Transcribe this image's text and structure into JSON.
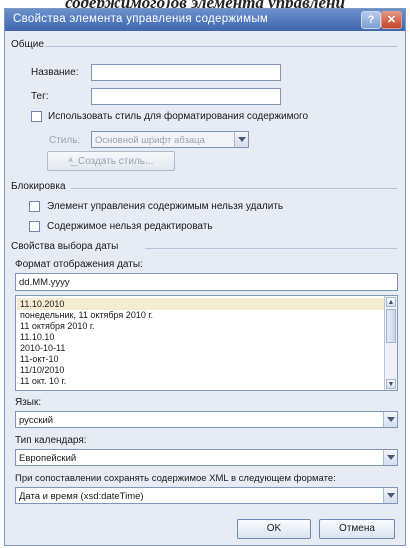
{
  "caption": "содержимого)ов элемента управлени",
  "dialog": {
    "title": "Свойства элемента управления содержимым",
    "help_glyph": "?",
    "close_glyph": "✕"
  },
  "general": {
    "heading": "Общие",
    "name_label": "Название:",
    "name_value": "",
    "tag_label": "Тег:",
    "tag_value": "",
    "use_style_label": "Использовать стиль для форматирования содержимого",
    "use_style_checked": false,
    "style_label": "Стиль:",
    "style_value": "Основной шрифт абзаца",
    "create_style_label": "Создать стиль..."
  },
  "locking": {
    "heading": "Блокировка",
    "cannot_delete_label": "Элемент управления содержимым нельзя удалить",
    "cannot_delete_checked": false,
    "cannot_edit_label": "Содержимое нельзя редактировать",
    "cannot_edit_checked": false
  },
  "date_props": {
    "heading": "Свойства выбора даты",
    "format_label": "Формат отображения даты:",
    "format_value": "dd.MM.yyyy",
    "formats": [
      "11.10.2010",
      "понедельник, 11 октября 2010 г.",
      "11 октября 2010 г.",
      "11.10.10",
      "2010-10-11",
      "11-окт-10",
      "11/10/2010",
      "11 окт. 10 г."
    ],
    "language_label": "Язык:",
    "language_value": "русский",
    "calendar_label": "Тип календаря:",
    "calendar_value": "Европейский",
    "xml_label": "При сопоставлении сохранять содержимое XML в следующем формате:",
    "xml_value": "Дата и время (xsd:dateTime)"
  },
  "buttons": {
    "ok": "OK",
    "cancel": "Отмена"
  },
  "colors": {
    "titlebar": "#3f67ad",
    "dialog_bg": "#e7ecf4",
    "selected_row": "#f3ecd3"
  }
}
